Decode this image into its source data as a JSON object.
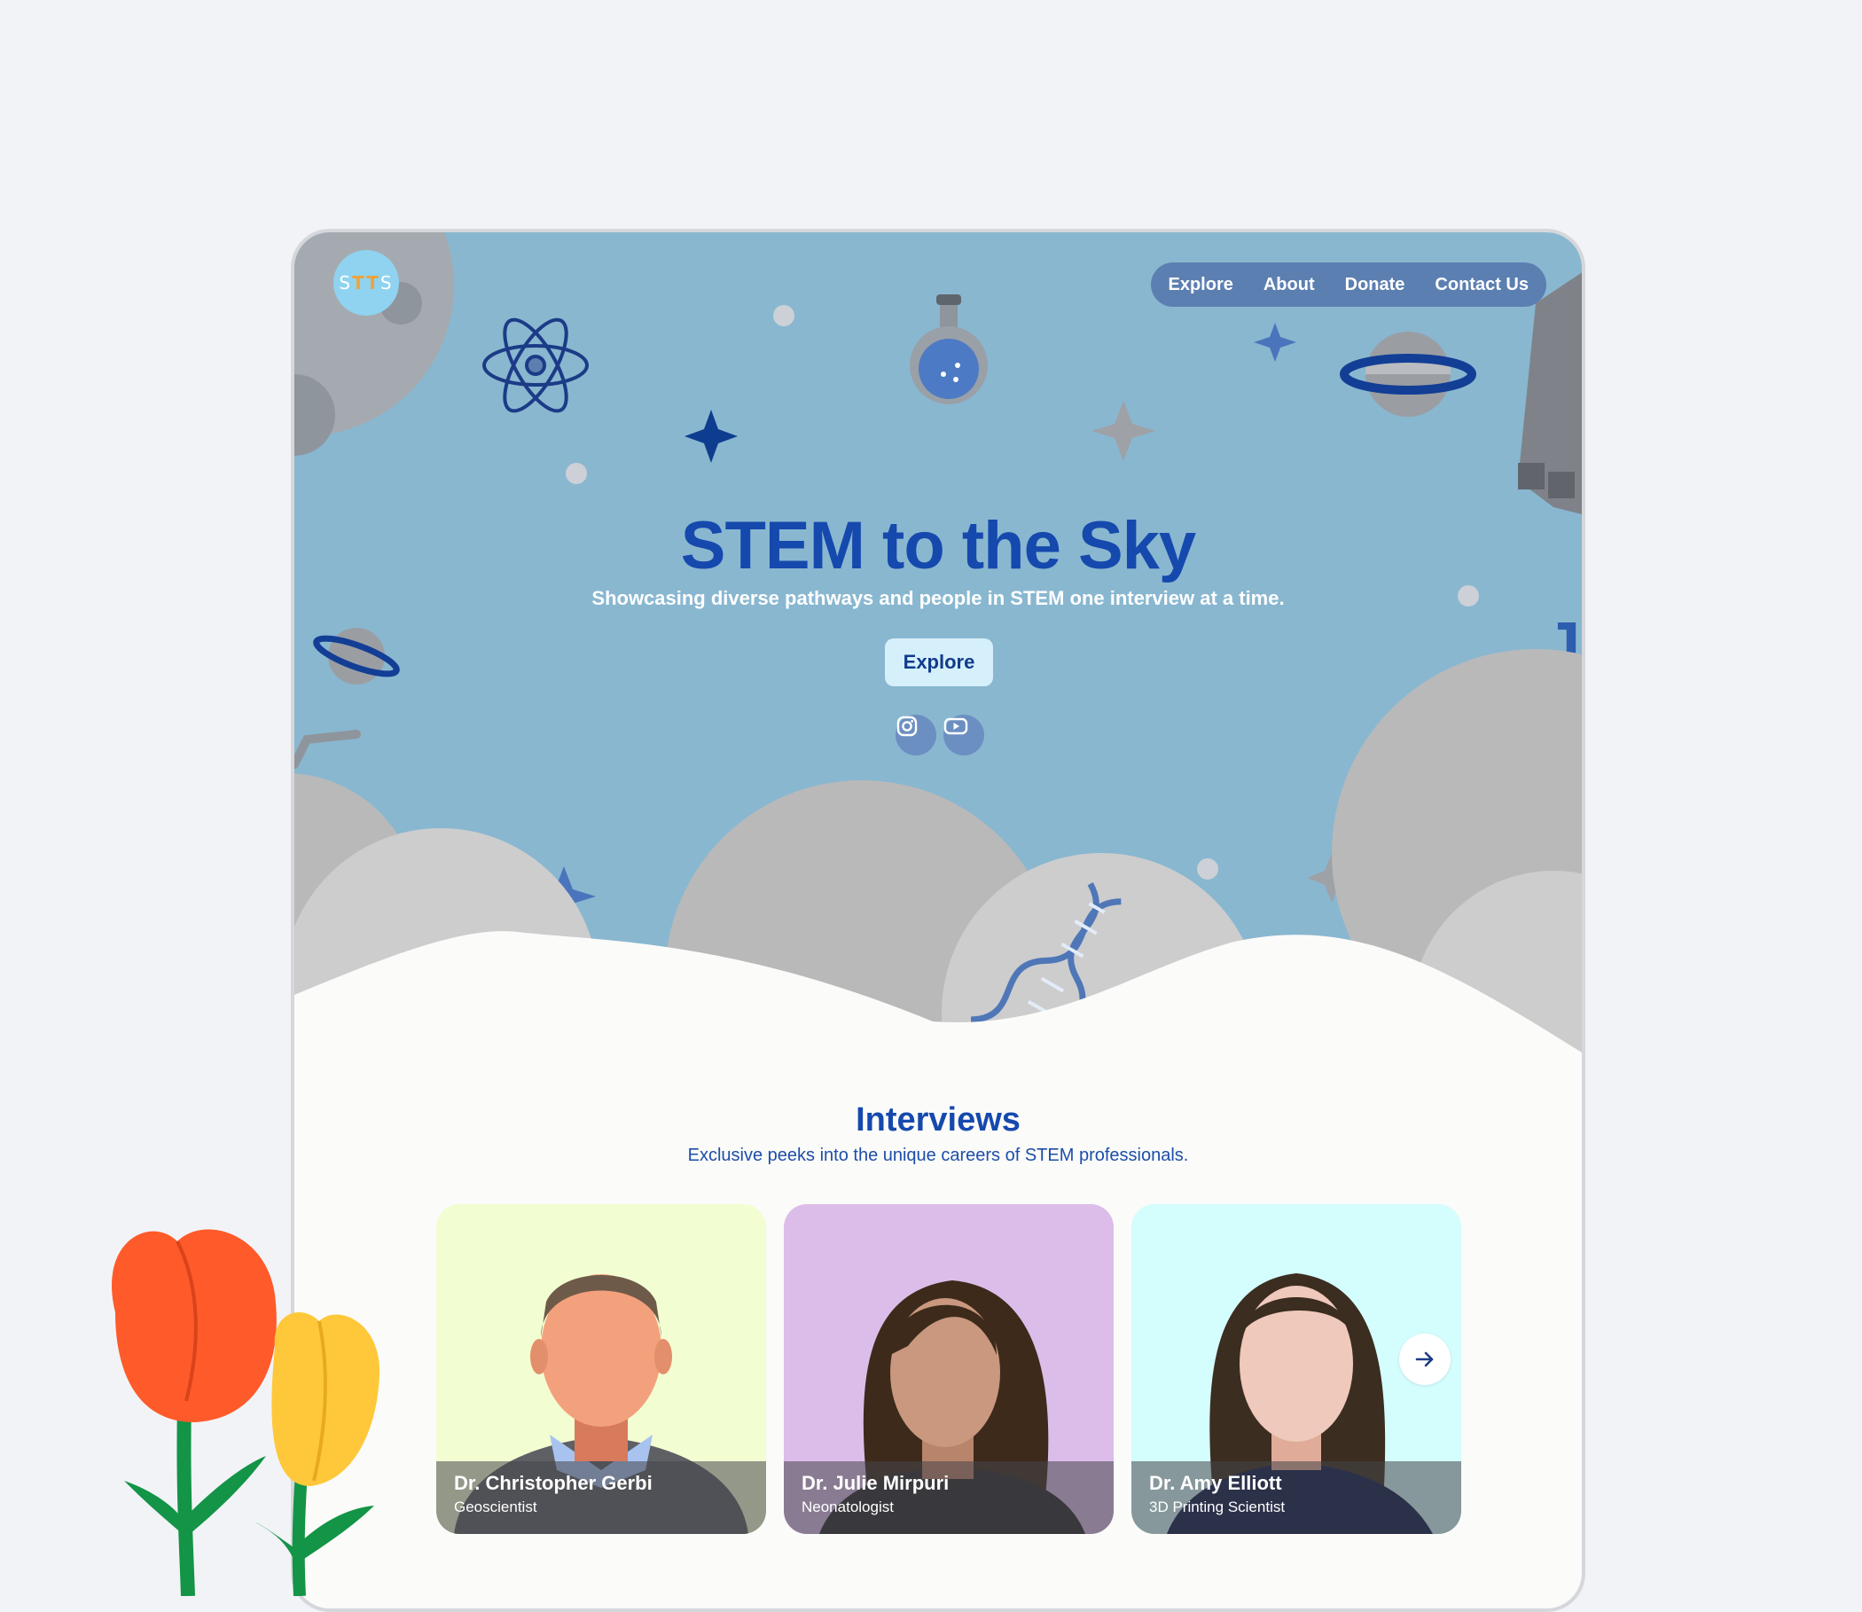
{
  "brand": {
    "logo_text_left": "S",
    "logo_text_mid": "TT",
    "logo_text_right": "S"
  },
  "nav": {
    "items": [
      {
        "label": "Explore"
      },
      {
        "label": "About"
      },
      {
        "label": "Donate"
      },
      {
        "label": "Contact Us"
      }
    ]
  },
  "hero": {
    "title": "STEM to the Sky",
    "subtitle": "Showcasing diverse pathways and people in STEM one interview at a time.",
    "cta_label": "Explore",
    "social": [
      "instagram-icon",
      "youtube-icon"
    ]
  },
  "interviews": {
    "title": "Interviews",
    "subtitle": "Exclusive peeks into the unique careers of STEM professionals.",
    "cards": [
      {
        "name": "Dr. Christopher Gerbi",
        "role": "Geoscientist",
        "bg": "#f3fdd2"
      },
      {
        "name": "Dr. Julie Mirpuri",
        "role": "Neonatologist",
        "bg": "#dcbde9"
      },
      {
        "name": "Dr. Amy Elliott",
        "role": "3D Printing Scientist",
        "bg": "#d4fdfd"
      }
    ]
  },
  "colors": {
    "sky": "#89b7d0",
    "accent": "#1549ad",
    "nav": "#5c7fb1",
    "cloud": "#bdbdbd"
  }
}
